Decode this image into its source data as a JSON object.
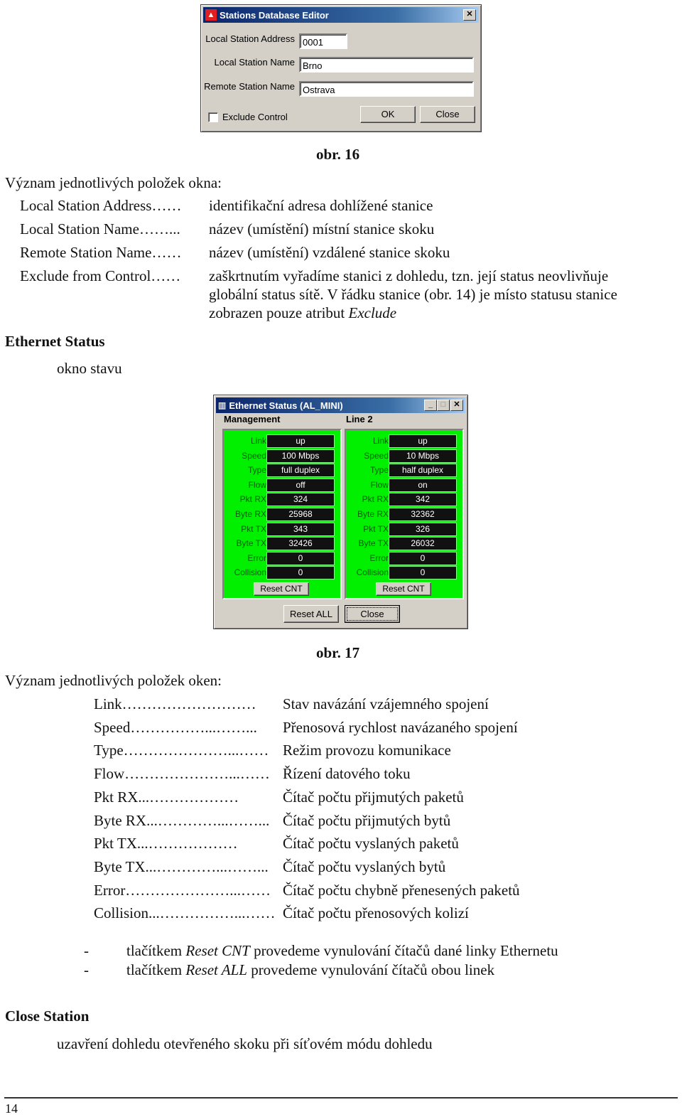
{
  "fig16": {
    "window_title": "Stations Database Editor",
    "labels": {
      "local_address": "Local Station Address",
      "local_name": "Local Station Name",
      "remote_name": "Remote Station Name",
      "exclude": "Exclude Control"
    },
    "values": {
      "local_address": "0001",
      "local_name": "Brno",
      "remote_name": "Ostrava",
      "exclude_checked": false
    },
    "buttons": {
      "ok": "OK",
      "close": "Close"
    },
    "close_glyph": "✕",
    "caption": "obr. 16"
  },
  "section1": {
    "intro": "Význam jednotlivých položek okna:",
    "items": [
      {
        "term": "Local Station Address……",
        "desc": "identifikační adresa dohlížené stanice"
      },
      {
        "term": "Local Station Name……...",
        "desc": "název (umístění) místní stanice skoku"
      },
      {
        "term": "Remote Station Name……",
        "desc": "název (umístění) vzdálené stanice skoku"
      },
      {
        "term": "Exclude from Control……",
        "desc_lines": [
          "zaškrtnutím vyřadíme stanici z dohledu, tzn. její status neovlivňuje",
          "globální status sítě. V řádku stanice (obr. 14) je místo statusu stanice",
          "zobrazen pouze atribut "
        ],
        "desc_italic": "Exclude"
      }
    ]
  },
  "ethernet_heading": "Ethernet Status",
  "ethernet_sub": "okno stavu",
  "fig17": {
    "window_title": "Ethernet Status (AL_MINI)",
    "title_buttons": {
      "minimize": "_",
      "maximize": "□",
      "close": "✕"
    },
    "groups": [
      {
        "title": "Management",
        "rows": [
          {
            "label": "Link",
            "value": "up"
          },
          {
            "label": "Speed",
            "value": "100 Mbps"
          },
          {
            "label": "Type",
            "value": "full duplex"
          },
          {
            "label": "Flow",
            "value": "off"
          },
          {
            "label": "Pkt RX",
            "value": "324"
          },
          {
            "label": "Byte RX",
            "value": "25968"
          },
          {
            "label": "Pkt TX",
            "value": "343"
          },
          {
            "label": "Byte TX",
            "value": "32426"
          },
          {
            "label": "Error",
            "value": "0"
          },
          {
            "label": "Collision",
            "value": "0"
          }
        ],
        "reset": "Reset CNT"
      },
      {
        "title": "Line 2",
        "rows": [
          {
            "label": "Link",
            "value": "up"
          },
          {
            "label": "Speed",
            "value": "10 Mbps"
          },
          {
            "label": "Type",
            "value": "half duplex"
          },
          {
            "label": "Flow",
            "value": "on"
          },
          {
            "label": "Pkt RX",
            "value": "342"
          },
          {
            "label": "Byte RX",
            "value": "32362"
          },
          {
            "label": "Pkt TX",
            "value": "326"
          },
          {
            "label": "Byte TX",
            "value": "26032"
          },
          {
            "label": "Error",
            "value": "0"
          },
          {
            "label": "Collision",
            "value": "0"
          }
        ],
        "reset": "Reset CNT"
      }
    ],
    "buttons": {
      "reset_all": "Reset ALL",
      "close": "Close"
    },
    "caption": "obr. 17"
  },
  "section2": {
    "intro": "Význam jednotlivých položek oken:",
    "items": [
      {
        "term": "Link………………………",
        "desc": "Stav navázání vzájemného spojení"
      },
      {
        "term": "Speed……………...……...",
        "desc": "Přenosová rychlost navázaného spojení"
      },
      {
        "term": "Type…………………...……",
        "desc": "Režim provozu komunikace"
      },
      {
        "term": "Flow…………………...……",
        "desc": "Řízení datového toku"
      },
      {
        "term": "Pkt RX...………………",
        "desc": "Čítač počtu přijmutých paketů"
      },
      {
        "term": "Byte RX...…………...……...",
        "desc": "Čítač počtu přijmutých bytů"
      },
      {
        "term": "Pkt TX...………………",
        "desc": "Čítač počtu vyslaných paketů"
      },
      {
        "term": "Byte TX...…………...……...",
        "desc": "Čítač počtu vyslaných bytů"
      },
      {
        "term": "Error…………………...……",
        "desc": "Čítač počtu chybně přenesených paketů"
      },
      {
        "term": "Collision...……………...……",
        "desc": "Čítač počtu přenosových kolizí"
      }
    ]
  },
  "bullets": [
    {
      "dash": "-",
      "pre": "tlačítkem ",
      "italic": "Reset CNT",
      "post": " provedeme vynulování čítačů dané linky Ethernetu"
    },
    {
      "dash": "-",
      "pre": "tlačítkem ",
      "italic": "Reset ALL",
      "post": " provedeme vynulování čítačů obou linek"
    }
  ],
  "close_heading": "Close Station",
  "close_desc": "uzavření dohledu otevřeného skoku při síťovém módu dohledu",
  "page_number": "14"
}
